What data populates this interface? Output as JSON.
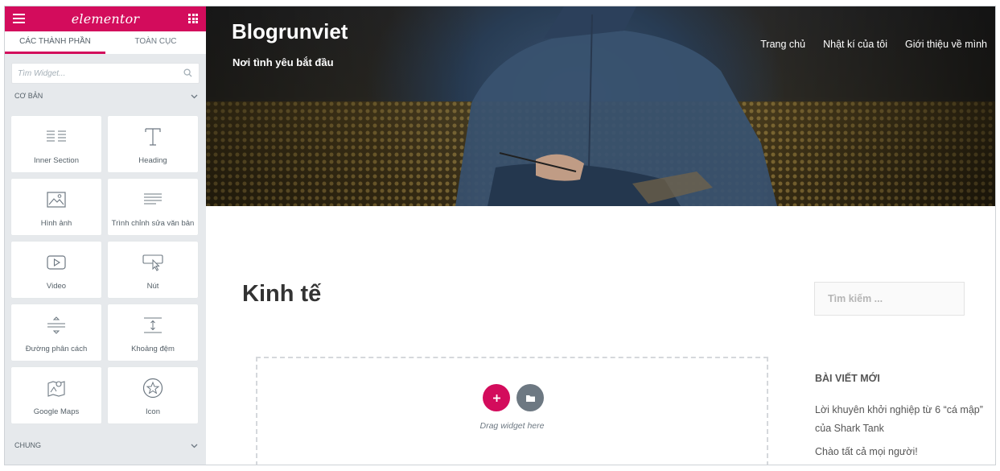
{
  "editor": {
    "logo": "elementor",
    "tabs": [
      "CÁC THÀNH PHẦN",
      "TOÀN CỤC"
    ],
    "search_placeholder": "Tìm Widget...",
    "section_basic": "CƠ BẢN",
    "section_general": "CHUNG",
    "widgets": [
      {
        "label": "Inner Section",
        "icon": "inner-section-icon"
      },
      {
        "label": "Heading",
        "icon": "heading-icon"
      },
      {
        "label": "Hình ảnh",
        "icon": "image-icon"
      },
      {
        "label": "Trình chỉnh sửa văn bản",
        "icon": "text-editor-icon"
      },
      {
        "label": "Video",
        "icon": "video-icon"
      },
      {
        "label": "Nút",
        "icon": "button-icon"
      },
      {
        "label": "Đường phân cách",
        "icon": "divider-icon"
      },
      {
        "label": "Khoảng đệm",
        "icon": "spacer-icon"
      },
      {
        "label": "Google Maps",
        "icon": "map-icon"
      },
      {
        "label": "Icon",
        "icon": "star-icon"
      }
    ],
    "accent_color": "#d30c5c"
  },
  "site": {
    "title": "Blogrunviet",
    "tagline": "Nơi tình yêu bắt đầu",
    "nav": [
      "Trang chủ",
      "Nhật kí của tôi",
      "Giới thiệu về mình"
    ]
  },
  "page": {
    "title": "Kinh tế",
    "drop_text": "Drag widget here"
  },
  "sidebar_widgets": {
    "search_placeholder": "Tìm kiếm ...",
    "recent_title": "BÀI VIẾT MỚI",
    "recent_posts": [
      "Lời khuyên khởi nghiệp từ 6 “cá mập” của Shark Tank",
      "Chào tất cả mọi người!"
    ]
  }
}
